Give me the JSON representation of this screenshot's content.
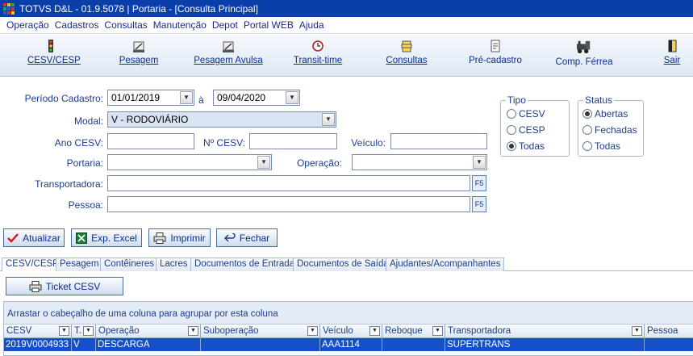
{
  "window": {
    "title": "TOTVS D&L - 01.9.5078 | Portaria - [Consulta Principal]"
  },
  "menu": [
    "Operação",
    "Cadastros",
    "Consultas",
    "Manutenção",
    "Depot",
    "Portal WEB",
    "Ajuda"
  ],
  "toolbar": [
    {
      "label": "CESV/CESP",
      "icon": "traffic-light-icon"
    },
    {
      "label": "Pesagem",
      "icon": "scale-icon"
    },
    {
      "label": "Pesagem Avulsa",
      "icon": "scale-icon"
    },
    {
      "label": "Transit-time",
      "icon": "clock-icon"
    },
    {
      "label": "Consultas",
      "icon": "stack-icon"
    },
    {
      "label": "Pré-cadastro",
      "icon": "document-icon"
    },
    {
      "label": "Comp. Férrea",
      "icon": "locomotive-icon"
    },
    {
      "label": "Sair",
      "icon": "exit-door-icon"
    }
  ],
  "filters": {
    "periodo_label": "Período Cadastro:",
    "date_from": "01/01/2019",
    "date_sep": "à",
    "date_to": "09/04/2020",
    "modal_label": "Modal:",
    "modal_value": "V - RODOVIÁRIO",
    "ano_cesv_label": "Ano CESV:",
    "ano_cesv_value": "",
    "no_cesv_label": "Nº CESV:",
    "no_cesv_value": "",
    "veiculo_label": "Veículo:",
    "veiculo_value": "",
    "portaria_label": "Portaria:",
    "portaria_value": "",
    "operacao_label": "Operação:",
    "operacao_value": "",
    "transportadora_label": "Transportadora:",
    "transportadora_value": "",
    "pessoa_label": "Pessoa:",
    "pessoa_value": "",
    "f5": "F5"
  },
  "tipo": {
    "title": "Tipo",
    "options": [
      {
        "label": "CESV",
        "selected": false
      },
      {
        "label": "CESP",
        "selected": false
      },
      {
        "label": "Todas",
        "selected": true
      }
    ]
  },
  "status": {
    "title": "Status",
    "options": [
      {
        "label": "Abertas",
        "selected": true
      },
      {
        "label": "Fechadas",
        "selected": false
      },
      {
        "label": "Todas",
        "selected": false
      }
    ]
  },
  "actions": {
    "atualizar": "Atualizar",
    "exp_excel": "Exp. Excel",
    "imprimir": "Imprimir",
    "fechar": "Fechar"
  },
  "tabs": [
    "CESV/CESP",
    "Pesagem",
    "Contêineres",
    "Lacres",
    "Documentos de Entrada",
    "Documentos de Saída",
    "Ajudantes/Acompanhantes"
  ],
  "ticket_button": "Ticket CESV",
  "grid": {
    "group_hint": "Arrastar o cabeçalho de uma coluna para agrupar por esta coluna",
    "columns": [
      "CESV",
      "T.",
      "Operação",
      "Suboperação",
      "Veículo",
      "Reboque",
      "Transportadora",
      "Pessoa"
    ],
    "rows": [
      [
        "2019V0004933",
        "V",
        "DESCARGA",
        "",
        "AAA1114",
        "",
        "SUPERTRANS",
        ""
      ]
    ]
  },
  "colors": {
    "titlebar": "#0a3ea8",
    "selection": "#1450c8",
    "accent": "#0b2f8c"
  }
}
